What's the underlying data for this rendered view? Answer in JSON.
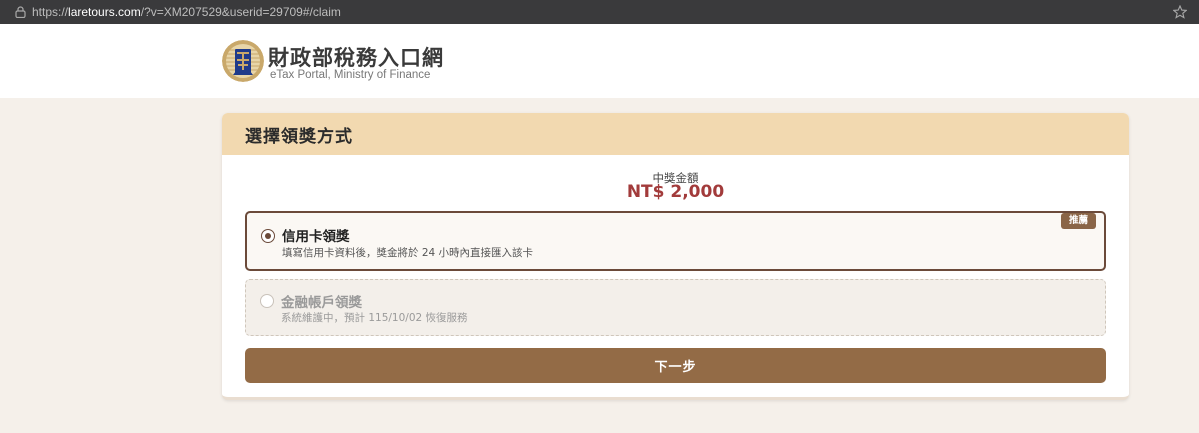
{
  "browser": {
    "url_prefix": "https://",
    "url_host": "laretours.com",
    "url_path": "/?v=XM207529&userid=29709#/claim"
  },
  "header": {
    "title": "財政部稅務入口網",
    "subtitle": "eTax Portal, Ministry of Finance"
  },
  "card": {
    "title": "選擇領獎方式",
    "amount_label": "中獎金額",
    "amount_value": "NT$ 2,000",
    "options": [
      {
        "title": "信用卡領獎",
        "description": "填寫信用卡資料後，獎金將於 24 小時內直接匯入該卡",
        "badge": "推薦",
        "selected": true,
        "disabled": false
      },
      {
        "title": "金融帳戶領獎",
        "description": "系統維護中，預計 115/10/02 恢復服務",
        "selected": false,
        "disabled": true
      }
    ],
    "next_label": "下一步"
  },
  "colors": {
    "card_header": "#f2d9b0",
    "accent_brown": "#936b46",
    "selected_border": "#6b4a3a",
    "amount": "#a23b3b"
  },
  "icons": {
    "lock": "lock-icon",
    "star": "star-icon",
    "logo": "ministry-seal-logo"
  }
}
